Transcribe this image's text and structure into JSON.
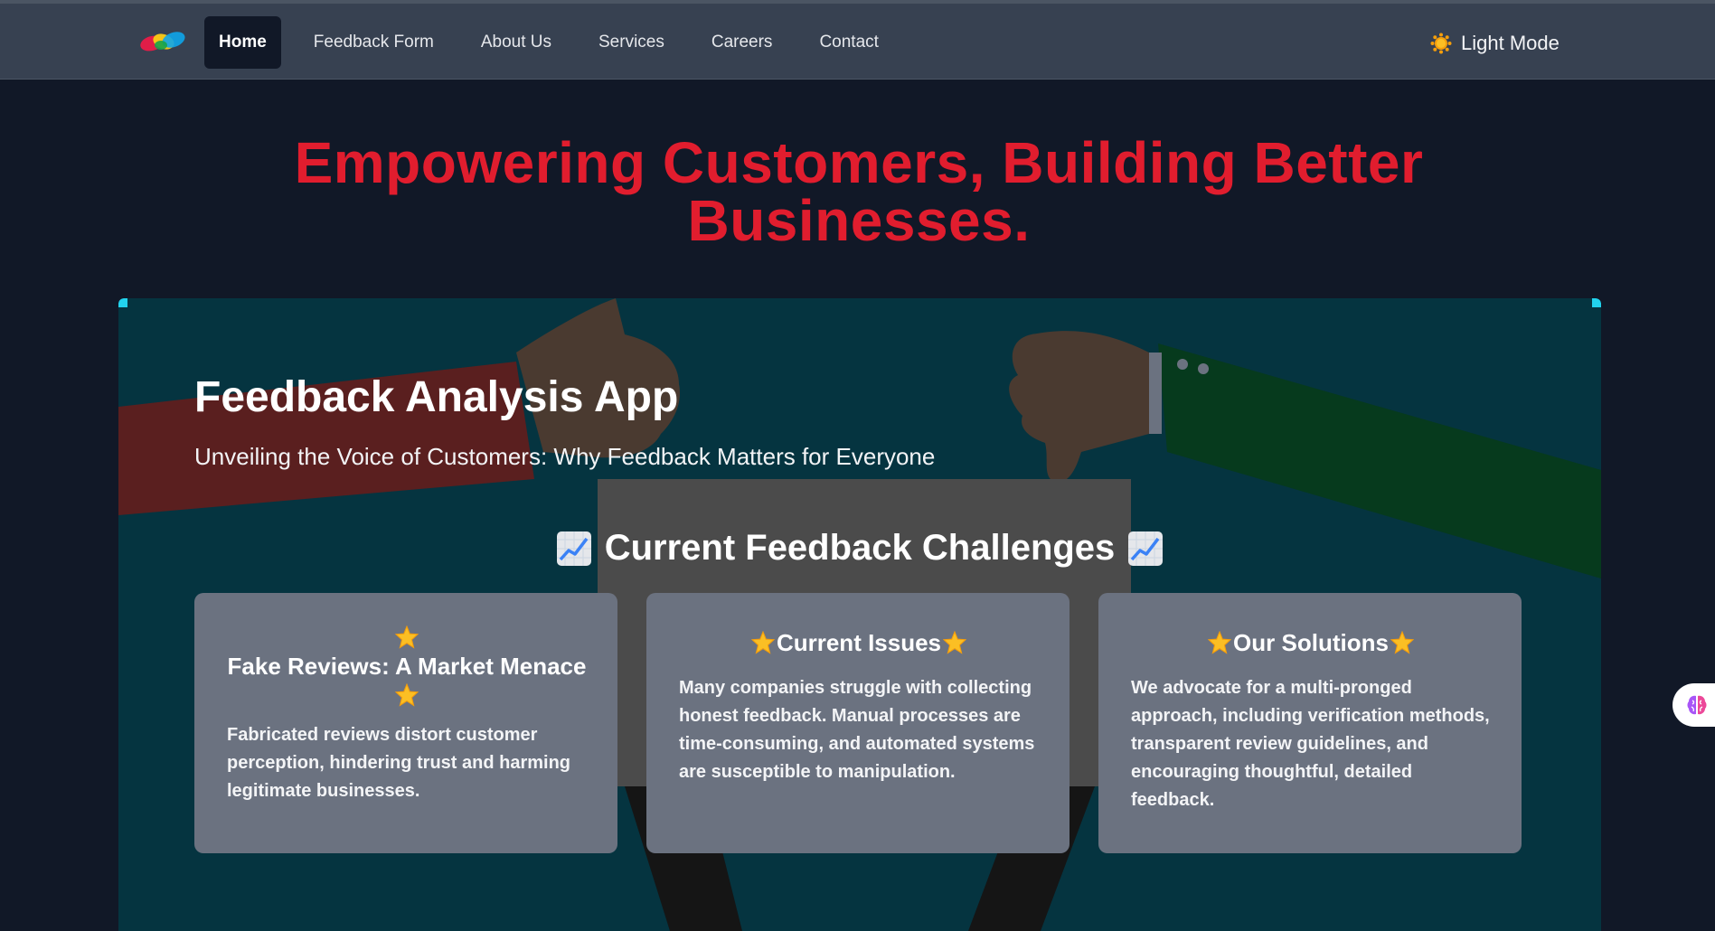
{
  "nav": {
    "links": [
      {
        "label": "Home",
        "active": true
      },
      {
        "label": "Feedback Form",
        "active": false
      },
      {
        "label": "About Us",
        "active": false
      },
      {
        "label": "Services",
        "active": false
      },
      {
        "label": "Careers",
        "active": false
      },
      {
        "label": "Contact",
        "active": false
      }
    ],
    "mode_toggle_label": "Light Mode",
    "mode_icon": "sun-icon",
    "logo_icon": "brand-logo-icon"
  },
  "hero": {
    "title": "Empowering Customers, Building Better Businesses."
  },
  "panel": {
    "app_title": "Feedback Analysis App",
    "app_subtitle": "Unveiling the Voice of Customers: Why Feedback Matters for Everyone",
    "section_title": "Current Feedback Challenges",
    "section_icon": "chart-increasing-icon",
    "cards": [
      {
        "title": "Fake Reviews: A Market Menace",
        "text": "Fabricated reviews distort customer perception, hindering trust and harming legitimate businesses."
      },
      {
        "title": "Current Issues",
        "text": "Many companies struggle with collecting honest feedback. Manual processes are time-consuming, and automated systems are susceptible to manipulation."
      },
      {
        "title": "Our Solutions",
        "text": "We advocate for a multi-pronged approach, including verification methods, transparent review guidelines, and encouraging thoughtful, detailed feedback."
      }
    ]
  },
  "widget": {
    "icon": "brain-icon"
  },
  "colors": {
    "nav_bg": "#374151",
    "page_bg": "#111827",
    "hero_title": "#e11d2e",
    "panel_bg": "#053440",
    "card_bg": "#6b7280"
  }
}
